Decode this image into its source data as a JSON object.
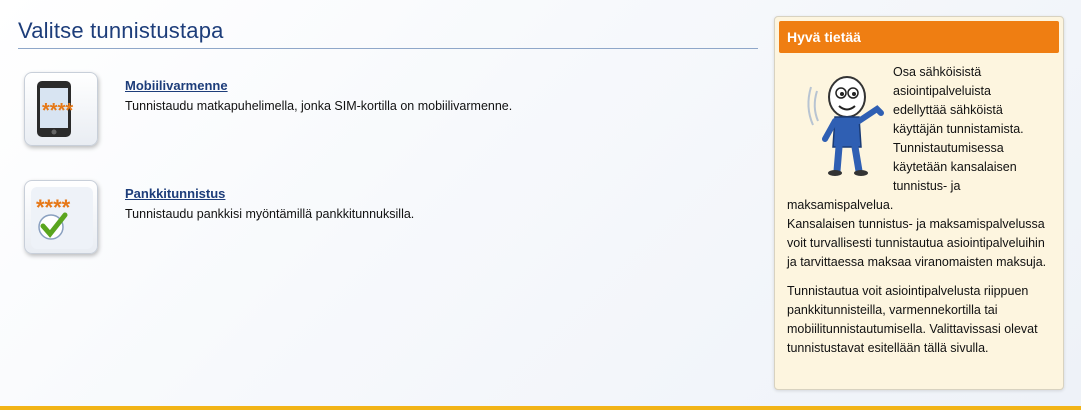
{
  "main": {
    "title": "Valitse tunnistustapa",
    "methods": [
      {
        "title": "Mobiilivarmenne",
        "description": "Tunnistaudu matkapuhelimella, jonka SIM-kortilla on mobiilivarmenne.",
        "icon": "mobile-phone-icon"
      },
      {
        "title": "Pankkitunnistus",
        "description": "Tunnistaudu pankkisi myöntämillä pankkitunnuksilla.",
        "icon": "bank-checkmark-icon"
      }
    ]
  },
  "info_box": {
    "title": "Hyvä tietää",
    "p1_lines": [
      "Osa sähköisistä",
      "asiointipalveluista",
      "edellyttää sähköistä",
      "käyttäjän tunnistamista.",
      "Tunnistautumisessa",
      "käytetään kansalaisen",
      "tunnistus- ja"
    ],
    "p1_tail": "maksamispalvelua.",
    "p2": "Kansalaisen tunnistus- ja maksamispalvelussa voit turvallisesti tunnistautua asiointipalveluihin ja tarvittaessa maksaa viranomaisten maksuja.",
    "p3": "Tunnistautua voit asiointipalvelusta riippuen pankkitunnisteilla, varmennekortilla tai mobiilitunnistautumisella. Valittavissasi olevat tunnistustavat esitellään tällä sivulla."
  },
  "colors": {
    "accent": "#ef7e12",
    "title": "#1d3d7a",
    "info_bg": "#fdf5df",
    "bottom_bar": "#f2b417"
  }
}
